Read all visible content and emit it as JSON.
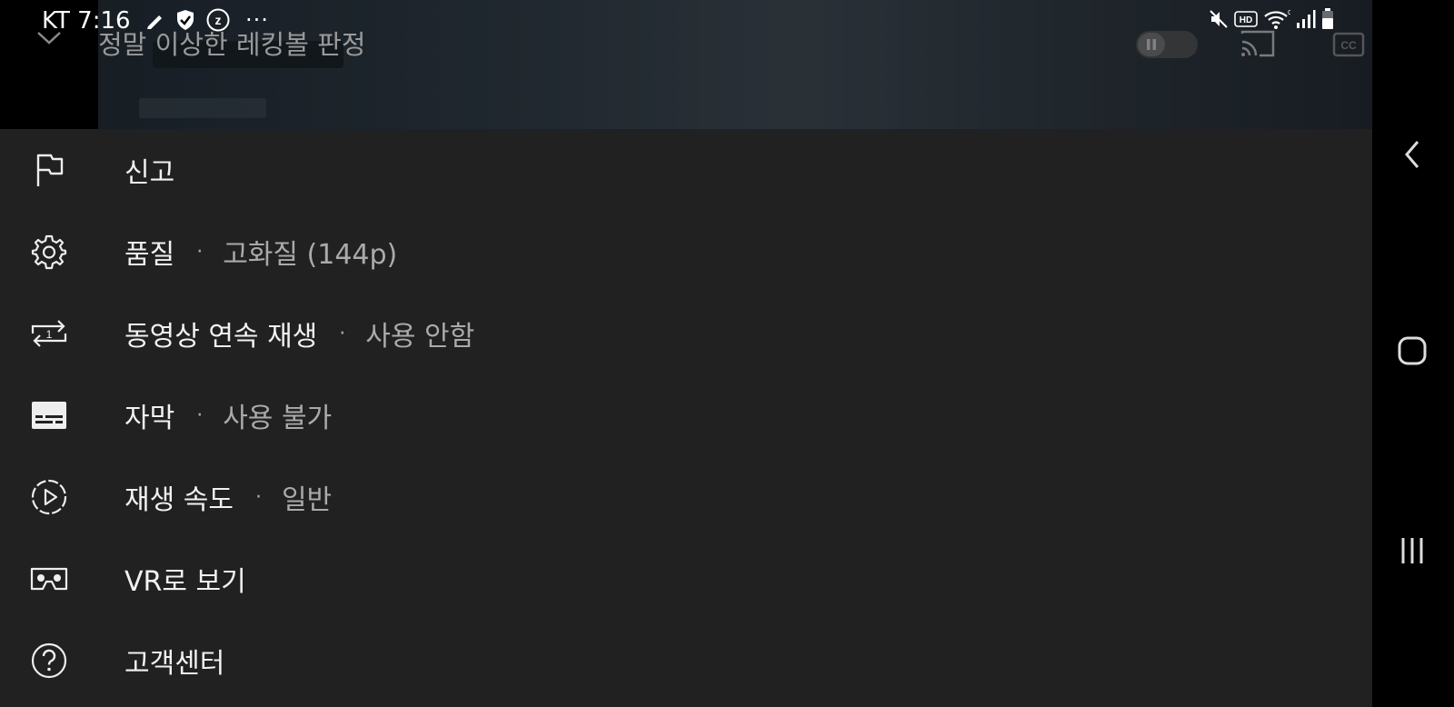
{
  "status_bar": {
    "time": "KT 7:16",
    "left_icons": [
      "pencil-icon",
      "shield-check-icon",
      "z-circle-icon",
      "more-ellipsis"
    ],
    "right_icons": [
      "mute-icon",
      "hd-icon",
      "wifi-icon",
      "signal-icon",
      "battery-icon"
    ],
    "ellipsis": "···",
    "hd": "HD"
  },
  "video": {
    "title": "정말 이상한 레킹볼 판정",
    "controls": [
      "collapse-chevron-icon",
      "pause-toggle",
      "cast-icon",
      "cc-icon"
    ],
    "cc": "CC"
  },
  "menu": {
    "items": [
      {
        "label": "신고",
        "icon": "flag-icon"
      },
      {
        "label": "품질",
        "value": "고화질 (144p)",
        "icon": "gear-icon"
      },
      {
        "label": "동영상 연속 재생",
        "value": "사용 안함",
        "icon": "repeat-one-icon"
      },
      {
        "label": "자막",
        "value": "사용 불가",
        "icon": "subtitles-icon"
      },
      {
        "label": "재생 속도",
        "value": "일반",
        "icon": "playback-speed-icon"
      },
      {
        "label": "VR로 보기",
        "icon": "vr-icon"
      },
      {
        "label": "고객센터",
        "icon": "help-icon"
      }
    ],
    "separator": "·"
  },
  "nav_bar": {
    "buttons": [
      "back-icon",
      "home-icon",
      "recents-icon"
    ]
  },
  "colors": {
    "sheet_bg": "#212121",
    "label": "#f1f1f1",
    "secondary": "#aaaaaa",
    "nav_bg": "#000000"
  }
}
